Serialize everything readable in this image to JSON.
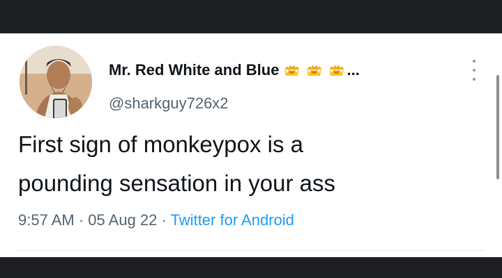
{
  "tweet": {
    "author": {
      "display_name": "Mr. Red White and Blue",
      "badges": [
        "crown-fire-emoji",
        "crown-fire-emoji",
        "crown-fire-emoji"
      ],
      "name_truncation": "...",
      "handle": "@sharkguy726x2",
      "avatar": "profile-photo"
    },
    "text_lines": [
      "First sign of monkeypox is a",
      "pounding sensation in your ass"
    ],
    "timestamp": "9:57 AM",
    "separator": "·",
    "date": "05 Aug 22",
    "source": "Twitter for Android",
    "more_icon": "vertical-ellipsis-icon"
  },
  "colors": {
    "frame": "#1e1f23",
    "card": "#ffffff",
    "text": "#0f1419",
    "muted": "#536471",
    "link": "#1d9bf0"
  }
}
